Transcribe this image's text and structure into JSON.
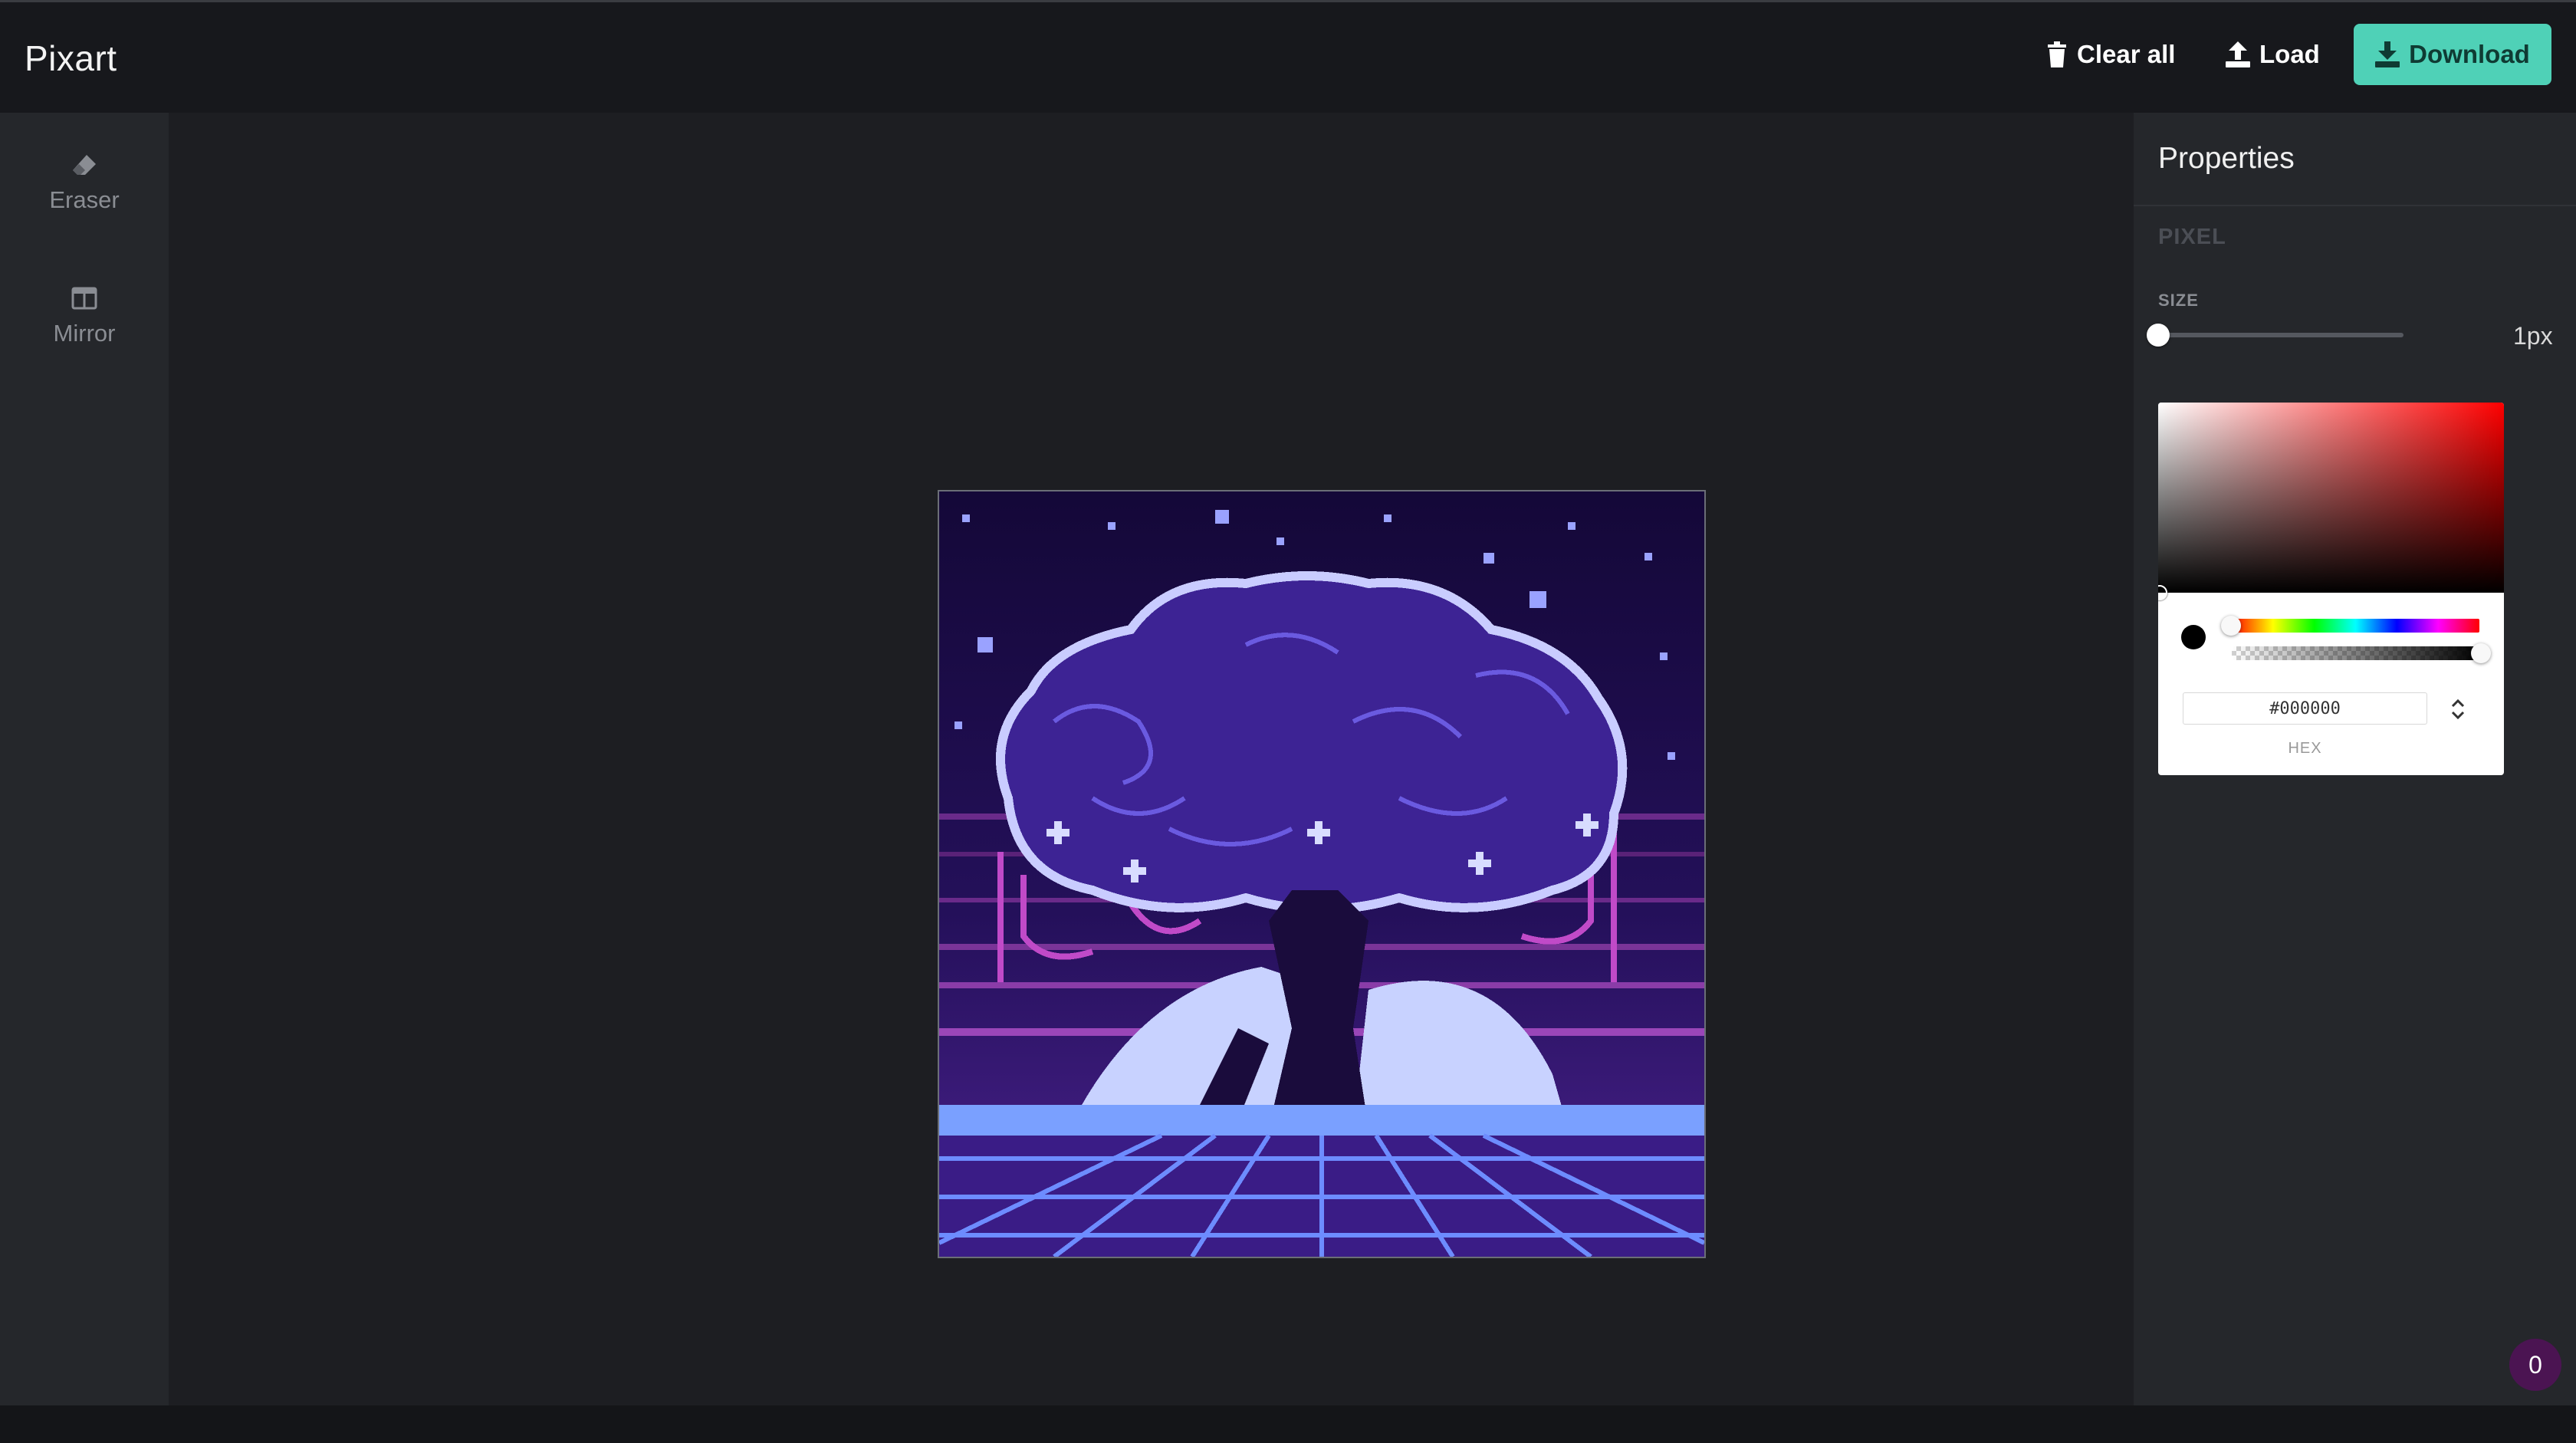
{
  "app": {
    "title": "Pixart"
  },
  "header": {
    "clear_label": "Clear all",
    "load_label": "Load",
    "download_label": "Download"
  },
  "tools": [
    {
      "label": "Eraser",
      "icon": "eraser-icon"
    },
    {
      "label": "Mirror",
      "icon": "mirror-icon"
    }
  ],
  "properties": {
    "title": "Properties",
    "section": "PIXEL",
    "size_label": "SIZE",
    "size_value": "1px",
    "size_level": 0
  },
  "color_picker": {
    "hex_value": "#000000",
    "hex_label": "HEX",
    "hue": 0,
    "alpha": 1
  },
  "artwork": {
    "description_icon": "pixel-art-canvas"
  },
  "badge": {
    "count": "0"
  },
  "colors": {
    "accent": "#4fd1b7",
    "badge": "#4b1452",
    "panel": "#25272b"
  }
}
